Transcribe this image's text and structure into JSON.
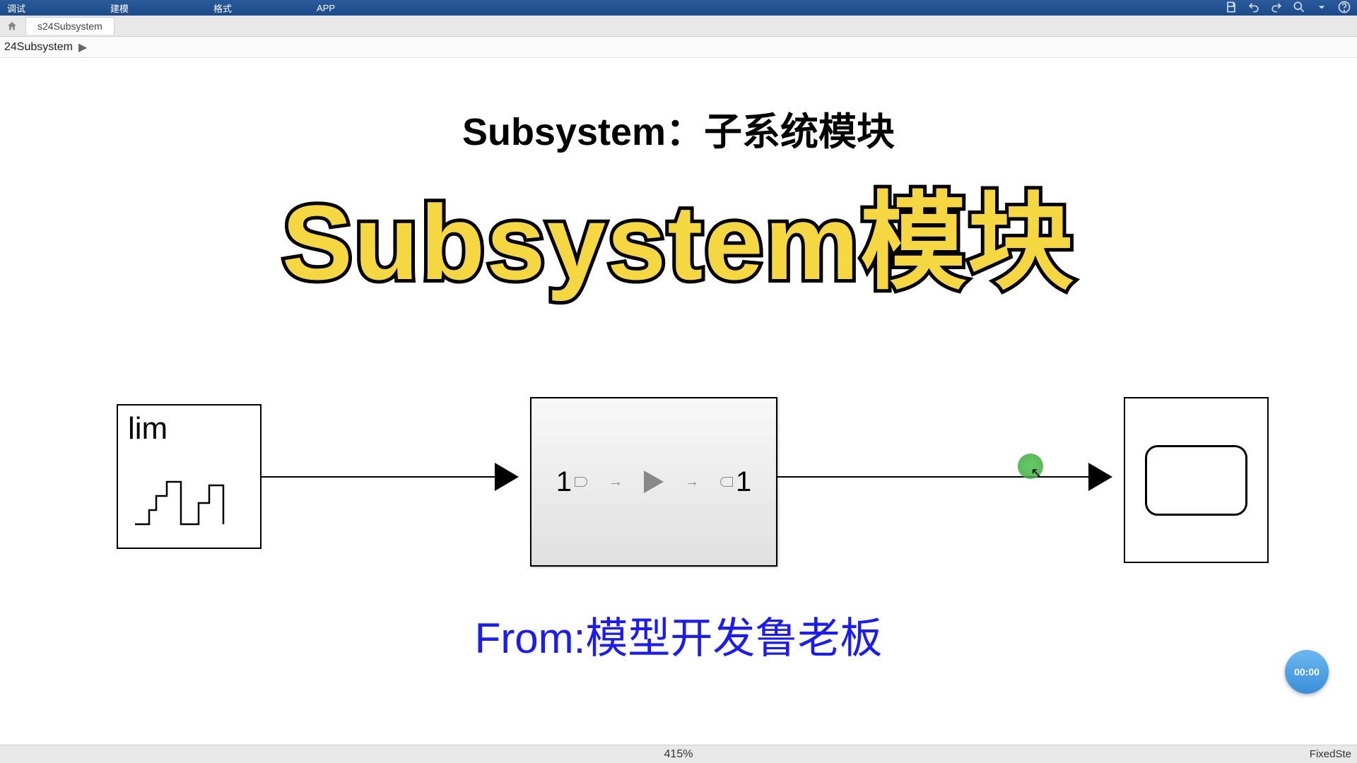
{
  "menu": {
    "debug": "调试",
    "model": "建模",
    "format": "格式",
    "app": "APP"
  },
  "tab": {
    "name": "s24Subsystem"
  },
  "breadcrumb": {
    "path": "24Subsystem"
  },
  "canvas": {
    "title": "Subsystem：子系统模块",
    "overlay": "Subsystem模块",
    "source_label": "lim",
    "sub_in": "1",
    "sub_out": "1",
    "credit": "From:模型开发鲁老板"
  },
  "time_badge": "00:00",
  "status": {
    "zoom": "415%",
    "solver": "FixedSte"
  }
}
